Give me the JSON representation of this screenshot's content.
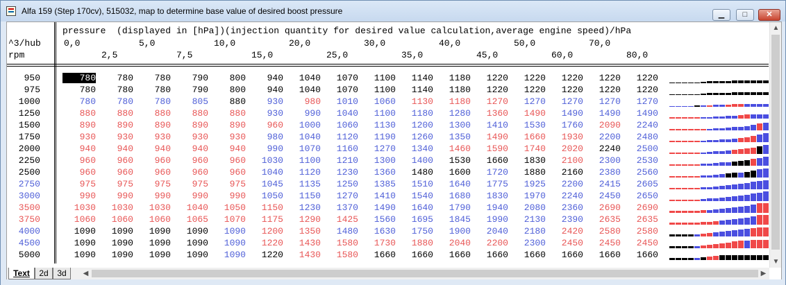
{
  "window": {
    "title": "Alfa 159 (Step 170cv), 515032, map to determine base value of desired boost pressure",
    "minimize_symbol": "▁",
    "maximize_symbol": "□",
    "close_symbol": "✕"
  },
  "table": {
    "corner_top": "^3/hub",
    "corner_bottom": "rpm",
    "axis_title": "pressure  (displayed in [hPa])(injection quantity for desired value calculation,average engine speed)/hPa",
    "col_headers_top": [
      "0,0",
      "5,0",
      "10,0",
      "20,0",
      "30,0",
      "40,0",
      "50,0",
      "70,0"
    ],
    "col_headers_bottom": [
      "2,5",
      "7,5",
      "15,0",
      "25,0",
      "35,0",
      "45,0",
      "60,0",
      "80,0"
    ],
    "rows": [
      {
        "rpm": "950",
        "values": [
          "780",
          "780",
          "780",
          "790",
          "800",
          "940",
          "1040",
          "1070",
          "1100",
          "1140",
          "1180",
          "1220",
          "1220",
          "1220",
          "1220",
          "1220"
        ],
        "colors": [
          "k",
          "k",
          "k",
          "k",
          "k",
          "k",
          "k",
          "k",
          "k",
          "k",
          "k",
          "k",
          "k",
          "k",
          "k",
          "k"
        ]
      },
      {
        "rpm": "975",
        "values": [
          "780",
          "780",
          "780",
          "790",
          "800",
          "940",
          "1040",
          "1070",
          "1100",
          "1140",
          "1180",
          "1220",
          "1220",
          "1220",
          "1220",
          "1220"
        ],
        "colors": [
          "k",
          "k",
          "k",
          "k",
          "k",
          "k",
          "k",
          "k",
          "k",
          "k",
          "k",
          "k",
          "k",
          "k",
          "k",
          "k"
        ]
      },
      {
        "rpm": "1000",
        "values": [
          "780",
          "780",
          "780",
          "805",
          "880",
          "930",
          "980",
          "1010",
          "1060",
          "1130",
          "1180",
          "1270",
          "1270",
          "1270",
          "1270",
          "1270"
        ],
        "colors": [
          "b",
          "b",
          "b",
          "b",
          "k",
          "b",
          "r",
          "b",
          "b",
          "r",
          "r",
          "r",
          "b",
          "b",
          "b",
          "b"
        ]
      },
      {
        "rpm": "1250",
        "values": [
          "880",
          "880",
          "880",
          "880",
          "880",
          "930",
          "990",
          "1040",
          "1100",
          "1180",
          "1280",
          "1360",
          "1490",
          "1490",
          "1490",
          "1490"
        ],
        "colors": [
          "r",
          "r",
          "r",
          "r",
          "r",
          "b",
          "b",
          "b",
          "b",
          "b",
          "b",
          "r",
          "r",
          "b",
          "b",
          "b"
        ]
      },
      {
        "rpm": "1500",
        "values": [
          "890",
          "890",
          "890",
          "890",
          "890",
          "960",
          "1000",
          "1060",
          "1130",
          "1200",
          "1300",
          "1410",
          "1530",
          "1760",
          "2090",
          "2240"
        ],
        "colors": [
          "r",
          "r",
          "r",
          "r",
          "r",
          "r",
          "b",
          "b",
          "b",
          "b",
          "b",
          "b",
          "b",
          "b",
          "r",
          "b"
        ]
      },
      {
        "rpm": "1750",
        "values": [
          "930",
          "930",
          "930",
          "930",
          "930",
          "980",
          "1040",
          "1120",
          "1190",
          "1260",
          "1350",
          "1490",
          "1660",
          "1930",
          "2200",
          "2480"
        ],
        "colors": [
          "r",
          "r",
          "r",
          "r",
          "r",
          "b",
          "b",
          "b",
          "b",
          "b",
          "b",
          "r",
          "r",
          "r",
          "b",
          "b"
        ]
      },
      {
        "rpm": "2000",
        "values": [
          "940",
          "940",
          "940",
          "940",
          "940",
          "990",
          "1070",
          "1160",
          "1270",
          "1340",
          "1460",
          "1590",
          "1740",
          "2020",
          "2240",
          "2500"
        ],
        "colors": [
          "r",
          "r",
          "r",
          "r",
          "r",
          "b",
          "b",
          "b",
          "b",
          "b",
          "r",
          "r",
          "r",
          "r",
          "k",
          "b"
        ]
      },
      {
        "rpm": "2250",
        "values": [
          "960",
          "960",
          "960",
          "960",
          "960",
          "1030",
          "1100",
          "1210",
          "1300",
          "1400",
          "1530",
          "1660",
          "1830",
          "2100",
          "2300",
          "2530"
        ],
        "colors": [
          "r",
          "r",
          "r",
          "r",
          "r",
          "b",
          "b",
          "b",
          "b",
          "b",
          "k",
          "k",
          "k",
          "r",
          "b",
          "b"
        ]
      },
      {
        "rpm": "2500",
        "values": [
          "960",
          "960",
          "960",
          "960",
          "960",
          "1040",
          "1120",
          "1230",
          "1360",
          "1480",
          "1600",
          "1720",
          "1880",
          "2160",
          "2380",
          "2560"
        ],
        "colors": [
          "r",
          "r",
          "r",
          "r",
          "r",
          "b",
          "b",
          "b",
          "b",
          "k",
          "k",
          "b",
          "k",
          "k",
          "b",
          "b"
        ]
      },
      {
        "rpm": "2750",
        "values": [
          "975",
          "975",
          "975",
          "975",
          "975",
          "1045",
          "1135",
          "1250",
          "1385",
          "1510",
          "1640",
          "1775",
          "1925",
          "2200",
          "2415",
          "2605"
        ],
        "colors": [
          "r",
          "r",
          "r",
          "r",
          "r",
          "b",
          "b",
          "b",
          "b",
          "b",
          "b",
          "b",
          "b",
          "b",
          "b",
          "b"
        ]
      },
      {
        "rpm": "3000",
        "values": [
          "990",
          "990",
          "990",
          "990",
          "990",
          "1050",
          "1150",
          "1270",
          "1410",
          "1540",
          "1680",
          "1830",
          "1970",
          "2240",
          "2450",
          "2650"
        ],
        "colors": [
          "r",
          "r",
          "r",
          "r",
          "r",
          "b",
          "b",
          "b",
          "b",
          "b",
          "b",
          "b",
          "b",
          "b",
          "b",
          "b"
        ]
      },
      {
        "rpm": "3500",
        "values": [
          "1030",
          "1030",
          "1030",
          "1040",
          "1050",
          "1150",
          "1230",
          "1370",
          "1490",
          "1640",
          "1790",
          "1940",
          "2080",
          "2360",
          "2690",
          "2690"
        ],
        "colors": [
          "r",
          "r",
          "r",
          "r",
          "r",
          "r",
          "b",
          "b",
          "b",
          "b",
          "b",
          "b",
          "b",
          "b",
          "r",
          "r"
        ]
      },
      {
        "rpm": "3750",
        "values": [
          "1060",
          "1060",
          "1060",
          "1065",
          "1070",
          "1175",
          "1290",
          "1425",
          "1560",
          "1695",
          "1845",
          "1990",
          "2130",
          "2390",
          "2635",
          "2635"
        ],
        "colors": [
          "r",
          "r",
          "r",
          "r",
          "r",
          "r",
          "r",
          "r",
          "b",
          "b",
          "b",
          "b",
          "b",
          "b",
          "r",
          "r"
        ]
      },
      {
        "rpm": "4000",
        "values": [
          "1090",
          "1090",
          "1090",
          "1090",
          "1090",
          "1200",
          "1350",
          "1480",
          "1630",
          "1750",
          "1900",
          "2040",
          "2180",
          "2420",
          "2580",
          "2580"
        ],
        "colors": [
          "k",
          "k",
          "k",
          "k",
          "b",
          "r",
          "r",
          "b",
          "b",
          "b",
          "b",
          "b",
          "b",
          "r",
          "r",
          "r"
        ]
      },
      {
        "rpm": "4500",
        "values": [
          "1090",
          "1090",
          "1090",
          "1090",
          "1090",
          "1220",
          "1430",
          "1580",
          "1730",
          "1880",
          "2040",
          "2200",
          "2300",
          "2450",
          "2450",
          "2450"
        ],
        "colors": [
          "k",
          "k",
          "k",
          "k",
          "b",
          "r",
          "r",
          "r",
          "r",
          "r",
          "r",
          "r",
          "b",
          "r",
          "r",
          "r"
        ]
      },
      {
        "rpm": "5000",
        "values": [
          "1090",
          "1090",
          "1090",
          "1090",
          "1090",
          "1220",
          "1430",
          "1580",
          "1660",
          "1660",
          "1660",
          "1660",
          "1660",
          "1660",
          "1660",
          "1660"
        ],
        "colors": [
          "k",
          "k",
          "k",
          "k",
          "b",
          "k",
          "r",
          "r",
          "k",
          "k",
          "k",
          "k",
          "k",
          "k",
          "k",
          "k"
        ]
      }
    ],
    "rpm_colors": [
      "k",
      "k",
      "k",
      "k",
      "k",
      "k",
      "k",
      "k",
      "k",
      "b",
      "b",
      "r",
      "r",
      "b",
      "b",
      "k"
    ],
    "selected_cell": {
      "row": 0,
      "col": 0
    }
  },
  "tabs": [
    "Text",
    "2d",
    "3d"
  ],
  "active_tab": "Text",
  "colors": {
    "k": "#000000",
    "r": "#e85656",
    "b": "#5060d8"
  },
  "icons": {
    "scroll_up": "▲",
    "scroll_down": "▼",
    "scroll_left": "◀",
    "scroll_right": "▶"
  }
}
